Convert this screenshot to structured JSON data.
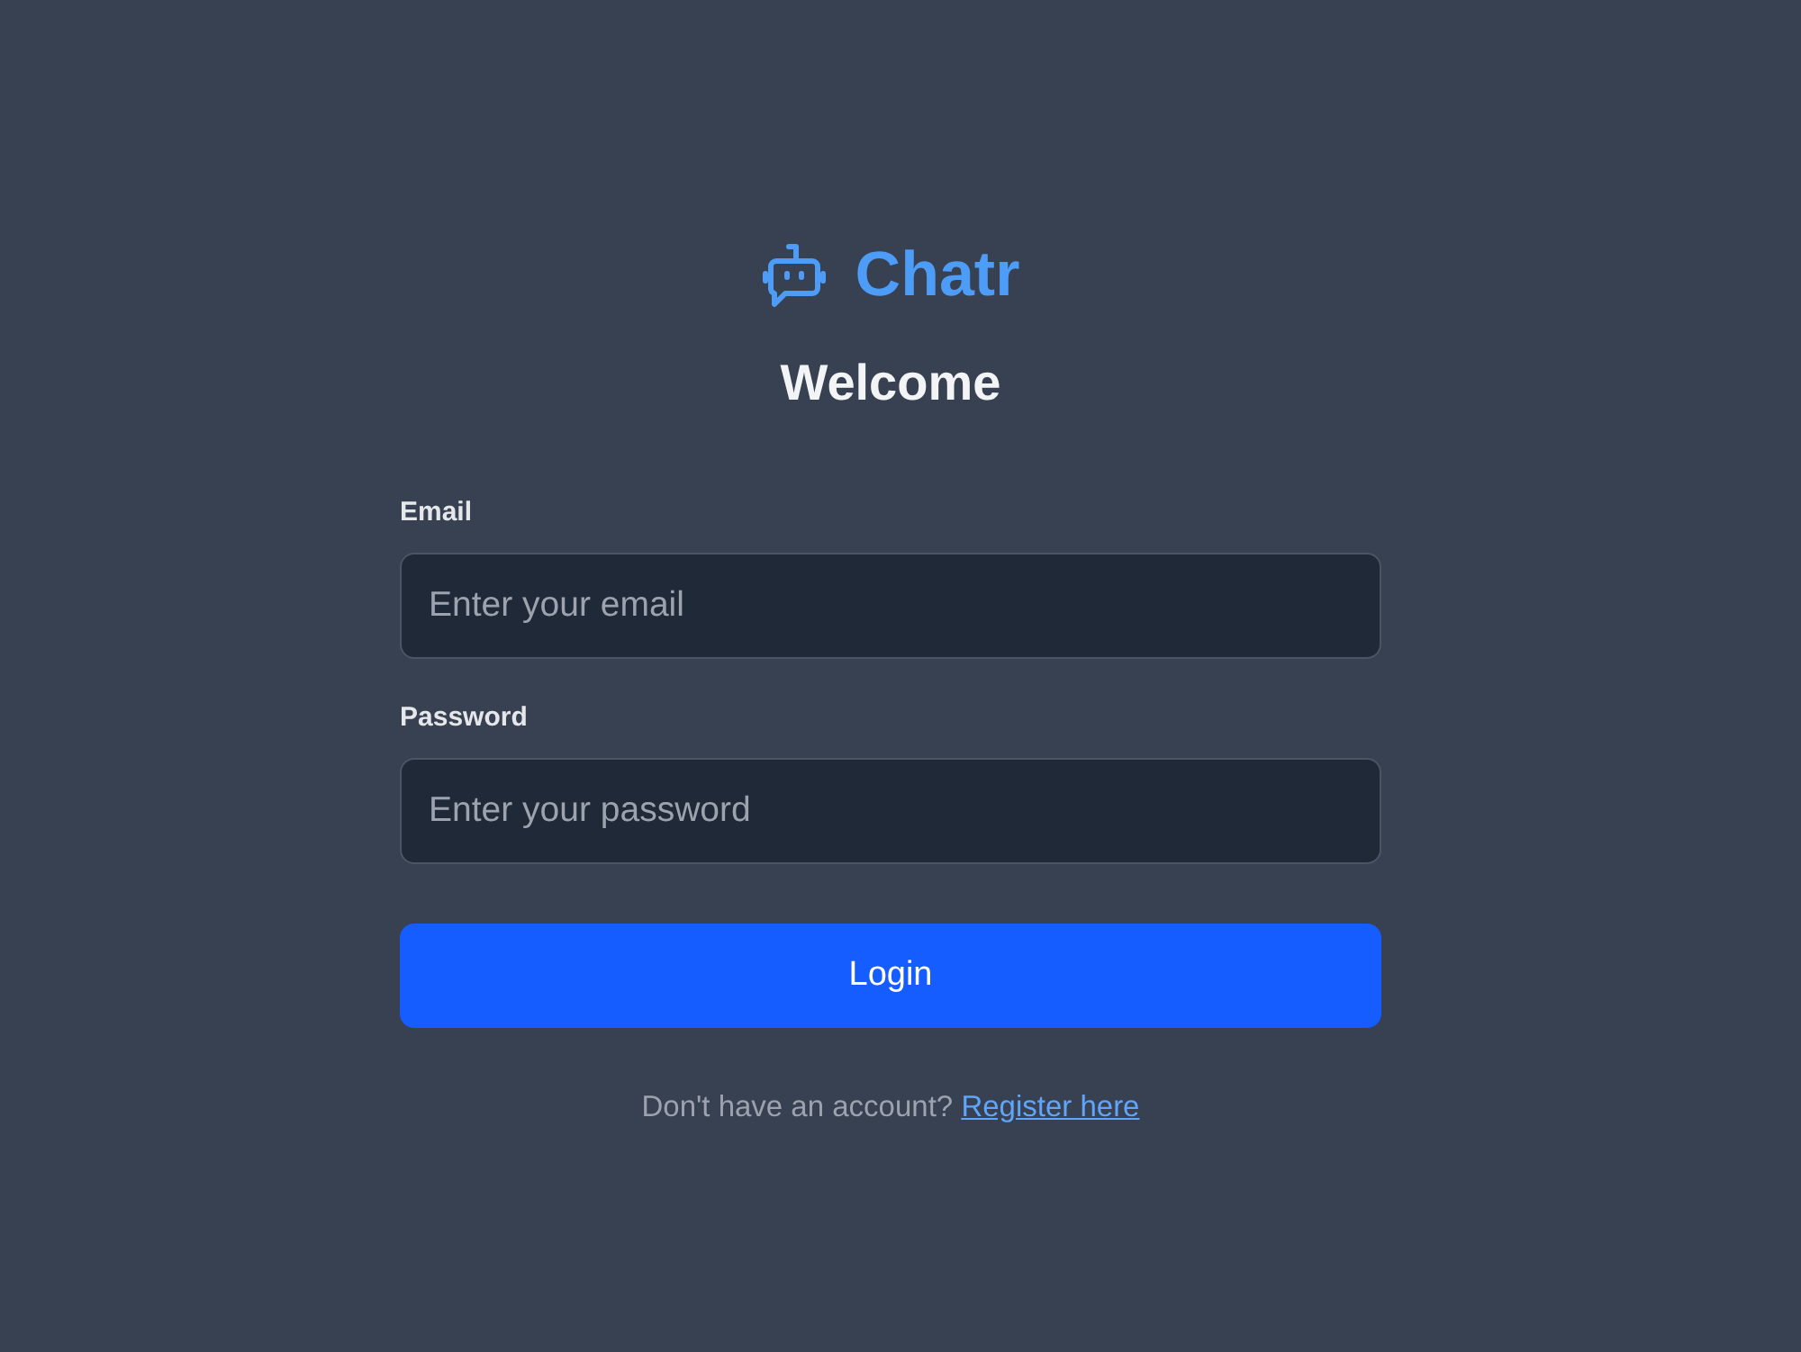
{
  "brand": {
    "name": "Chatr"
  },
  "heading": "Welcome",
  "fields": [
    {
      "label": "Email",
      "placeholder": "Enter your email"
    },
    {
      "label": "Password",
      "placeholder": "Enter your password"
    }
  ],
  "submit_button": "Login",
  "footer": {
    "text": "Don't have an account?",
    "link": "Register here"
  }
}
